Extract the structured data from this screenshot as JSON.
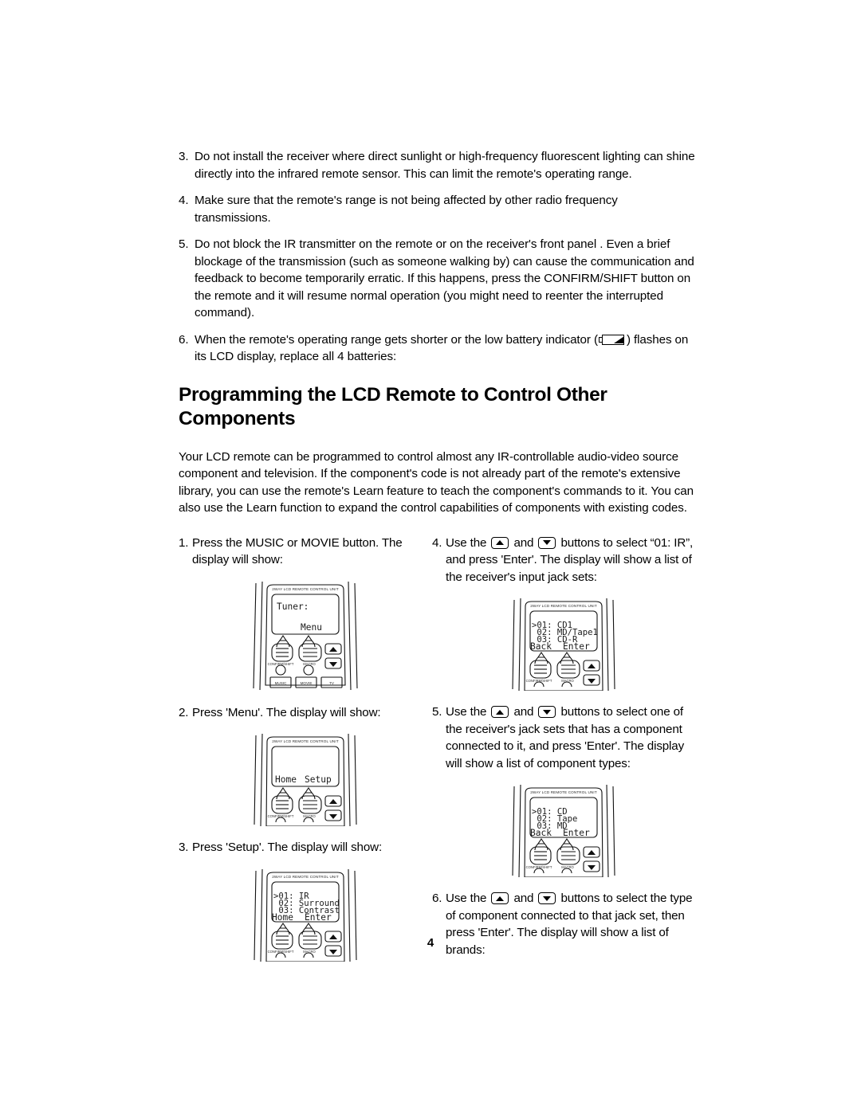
{
  "document": {
    "page_number": "4",
    "section_title": "Programming the LCD Remote to Control Other Components",
    "intro_paragraph": "Your LCD remote can be programmed to control almost any IR-controllable audio-video source component and television. If the component's code is not already part of the remote's extensive library, you can use the remote's Learn feature to teach the component's commands to it. You can also use the Learn function to expand the control capabilities of components with existing codes."
  },
  "notes": [
    {
      "number": "3.",
      "text": "Do not install the receiver where direct sunlight or high-frequency fluorescent lighting can shine directly into the infrared remote sensor. This can limit the remote's operating range."
    },
    {
      "number": "4.",
      "text": "Make sure that the remote's range is not being affected by other radio frequency transmissions."
    },
    {
      "number": "5.",
      "text": "Do not block the IR transmitter on the remote or on the receiver's front panel . Even a brief blockage of the transmission (such as someone walking by) can cause the communication and feedback to become temporarily erratic. If this happens, press the CONFIRM/SHIFT button on the remote and it will resume normal operation (you might need to reenter the interrupted command)."
    },
    {
      "number": "6.",
      "text_before_icon": "When the remote's operating range gets shorter or the low battery indicator (",
      "icon": "low-battery-icon",
      "text_after_icon": ") flashes on its LCD display, replace all 4 batteries:"
    }
  ],
  "steps": {
    "left": [
      {
        "number": "1.",
        "text": "Press the MUSIC or MOVIE button. The display will show:"
      },
      {
        "number": "2.",
        "text": "Press 'Menu'. The display will show:"
      },
      {
        "number": "3.",
        "text": "Press 'Setup'. The display will show:"
      }
    ],
    "right": [
      {
        "number": "4.",
        "part1": "Use the",
        "icon_up": "arrow-up-button-icon",
        "mid": "and",
        "icon_down": "arrow-down-button-icon",
        "part2": "buttons to select “01: IR”, and press 'Enter'. The display will show a list of the receiver's input jack sets:"
      },
      {
        "number": "5.",
        "part1": "Use the",
        "icon_up": "arrow-up-button-icon",
        "mid": "and",
        "icon_down": "arrow-down-button-icon",
        "part2": "buttons to select one of the receiver's jack sets that has a component connected to it, and press 'Enter'. The display will show a list of component types:"
      },
      {
        "number": "6.",
        "part1": "Use the",
        "icon_up": "arrow-up-button-icon",
        "mid": "and",
        "icon_down": "arrow-down-button-icon",
        "part2": "buttons to select the type of component connected to that jack set, then press 'Enter'. The display will show a list of brands:"
      }
    ]
  },
  "remote": {
    "header_label": "2WAY LCD REMOTE CONTROL UNIT",
    "pad_labels": {
      "left": "CONFIRM/SHIFT",
      "right": "MACRO"
    },
    "bottom_buttons": [
      "MUSIC",
      "MOVIE",
      "TV"
    ]
  },
  "figures": {
    "fig1_tuner": {
      "name": "remote-display-tuner",
      "lines_top": [
        "Tuner:"
      ],
      "softkeys": [
        "",
        "Menu"
      ],
      "has_bottom_buttons": true
    },
    "fig2_home_setup": {
      "name": "remote-display-home-setup",
      "lines_top": [],
      "softkeys": [
        "Home",
        "Setup"
      ],
      "has_bottom_buttons": false
    },
    "fig3_setup_list": {
      "name": "remote-display-setup-list",
      "lines_top": [
        ">01: IR",
        " 02: Surround",
        " 03: Contrast"
      ],
      "softkeys": [
        "Home",
        "Enter"
      ],
      "has_bottom_buttons": false
    },
    "fig4_jacksets": {
      "name": "remote-display-input-jack-sets",
      "lines_top": [
        ">01: CD1",
        " 02: MD/Tape1",
        " 03: CD-R"
      ],
      "softkeys": [
        "Back",
        "Enter"
      ],
      "has_bottom_buttons": false
    },
    "fig5_component_types": {
      "name": "remote-display-component-types",
      "lines_top": [
        ">01: CD",
        " 02: Tape",
        " 03: MD"
      ],
      "softkeys": [
        "Back",
        "Enter"
      ],
      "has_bottom_buttons": false
    }
  }
}
